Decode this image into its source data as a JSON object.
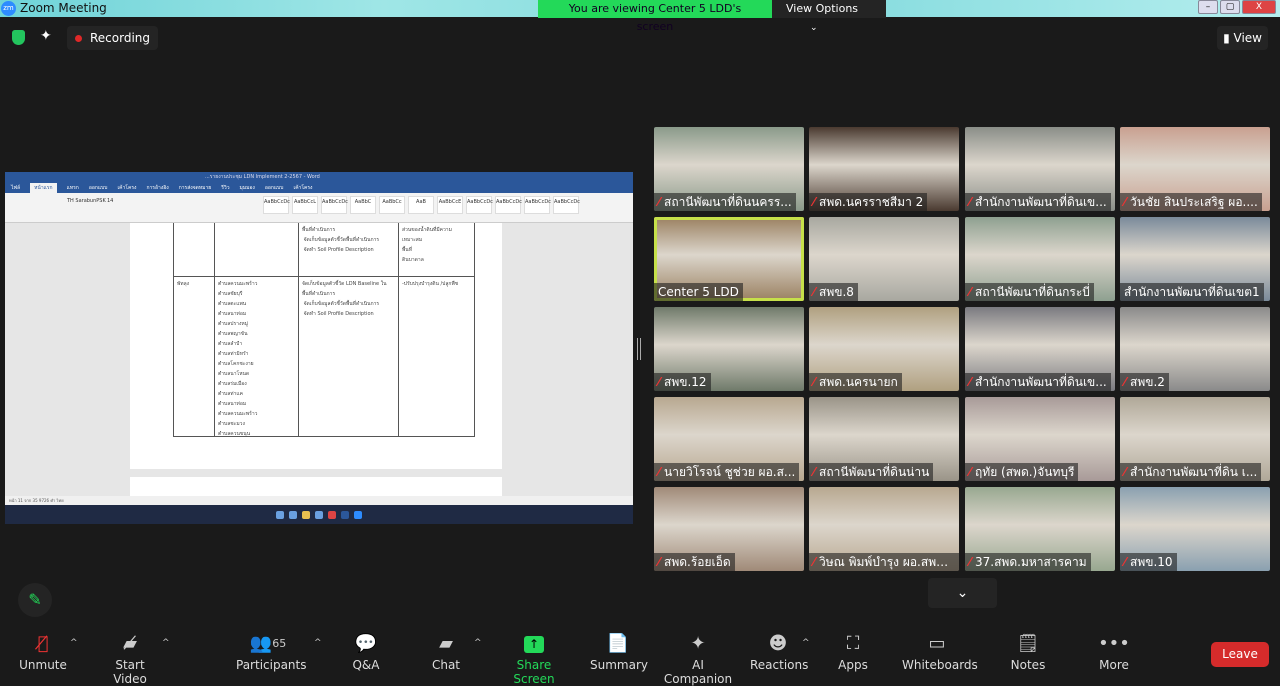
{
  "window": {
    "title": "Zoom Meeting",
    "banner": "You are viewing Center 5 LDD's screen",
    "view_options": "View Options",
    "minimize": "–",
    "maximize": "▢",
    "close": "X"
  },
  "topbar": {
    "recording": "Recording",
    "view": "View"
  },
  "shared_doc": {
    "title": "...รายงานประชุม LDN Implement 2-2567 - Word",
    "tabs": [
      "ไฟล์",
      "หน้าแรก",
      "แทรก",
      "ออกแบบ",
      "เค้าโครง",
      "การอ้างอิง",
      "การส่งจดหมาย",
      "รีวิว",
      "มุมมอง",
      "ออกแบบ",
      "เค้าโครง"
    ],
    "font": "TH SarabunPSK",
    "font_size": "14",
    "styles": [
      "AaBbCcDc",
      "AaBbCcL",
      "AaBbCcDc",
      "AaBbC",
      "AaBbCc",
      "AaB",
      "AaBbCcE",
      "AaBbCcDc",
      "AaBbCcDc",
      "AaBbCcDc",
      "AaBbCcDc"
    ],
    "province": "พัทลุง",
    "col3_top": "พื้นที่ดำเนินการ\n จัดเก็บข้อมูลตัวชี้วัดพื้นที่ดำเนินการ\n จัดทำ Soil Profile Description",
    "col3_bottom": "จัดเก็บข้อมูลตัวชี้วัด LDN Baseline ใน\nพื้นที่ดำเนินการ\n จัดเก็บข้อมูลตัวชี้วัดพื้นที่ดำเนินการ\n จัดทำ Soil Profile Description",
    "col2_bottom": "ตำบลควนมะพร้าว\nตำบลชัยบุรี\nตำบลตะแพน\nตำบลนาท่อม\nตำบลปรางหมู่\nตำบลพญาขัน\nตำบลลำปำ\nตำบลท่ามิหรำ\nตำบลโคกชะงาย\nตำบลนาโหนด\nตำบลร่มเมือง\nตำบลท่าแค\nตำบลนาท่อม\nตำบลควนมะพร้าว\nตำบลชะมวง\nตำบลควนขนุน",
    "col4_top": "ส่วนของน้ำดินที่มีความ\nเหมาะสม\nพื้นที่\nดินบาดาล",
    "col4_bottom": "-ปรับปรุงบำรุงดิน /ปลูกพืช",
    "status": "หน้า 11 จาก 35   9726 คำ   ไทย"
  },
  "gallery": [
    {
      "name": "สถานีพัฒนาที่ดินนครร...",
      "muted": true,
      "bg": "#8a9a8a"
    },
    {
      "name": "สพด.นครราชสีมา 2",
      "muted": true,
      "bg": "#4a3a30"
    },
    {
      "name": "สำนักงานพัฒนาที่ดินเข...",
      "muted": true,
      "bg": "#8a8e88"
    },
    {
      "name": "วันชัย สินประเสริฐ ผอ....",
      "muted": true,
      "bg": "#c9a090"
    },
    {
      "name": "Center 5 LDD",
      "muted": false,
      "active": true,
      "bg": "#9a8060"
    },
    {
      "name": "สพข.8",
      "muted": true,
      "bg": "#a8a8a0"
    },
    {
      "name": "สถานีพัฒนาที่ดินกระบี่",
      "muted": true,
      "bg": "#8ea090"
    },
    {
      "name": "สำนักงานพัฒนาที่ดินเขต1",
      "muted": false,
      "bg": "#7a8a9a"
    },
    {
      "name": "สพข.12",
      "muted": true,
      "bg": "#6f7a6a"
    },
    {
      "name": "สพด.นครนายก",
      "muted": true,
      "bg": "#b0a080"
    },
    {
      "name": "สำนักงานพัฒนาที่ดินเข...",
      "muted": true,
      "bg": "#7a7a80"
    },
    {
      "name": "สพข.2",
      "muted": true,
      "bg": "#8a8a8a"
    },
    {
      "name": "นายวิโรจน์ ชูช่วย ผอ.ส...",
      "muted": true,
      "bg": "#b8a890"
    },
    {
      "name": "สถานีพัฒนาที่ดินน่าน",
      "muted": true,
      "bg": "#9a9488"
    },
    {
      "name": "ฤทัย (สพด.)จันทบุรี",
      "muted": true,
      "bg": "#a89a98"
    },
    {
      "name": "สำนักงานพัฒนาที่ดิน เ...",
      "muted": true,
      "bg": "#b0a898"
    },
    {
      "name": "สพด.ร้อยเอ็ด",
      "muted": true,
      "bg": "#a08a78"
    },
    {
      "name": "วิษณ พิมพ์บำรุง ผอ.สพด...",
      "muted": true,
      "bg": "#b8a890"
    },
    {
      "name": "37.สพด.มหาสารคาม",
      "muted": true,
      "bg": "#98a890"
    },
    {
      "name": "สพข.10",
      "muted": true,
      "bg": "#8aa0b0"
    }
  ],
  "toolbar": {
    "unmute": "Unmute",
    "start_video": "Start Video",
    "participants": "Participants",
    "participant_count": "65",
    "qa": "Q&A",
    "chat": "Chat",
    "share_screen": "Share Screen",
    "summary": "Summary",
    "ai_companion": "AI Companion",
    "reactions": "Reactions",
    "apps": "Apps",
    "whiteboards": "Whiteboards",
    "notes": "Notes",
    "more": "More",
    "leave": "Leave"
  },
  "colors": {
    "accent_green": "#23d959",
    "leave_red": "#d52b2b",
    "active_speaker": "#c6e04a",
    "word_blue": "#2b579a"
  }
}
